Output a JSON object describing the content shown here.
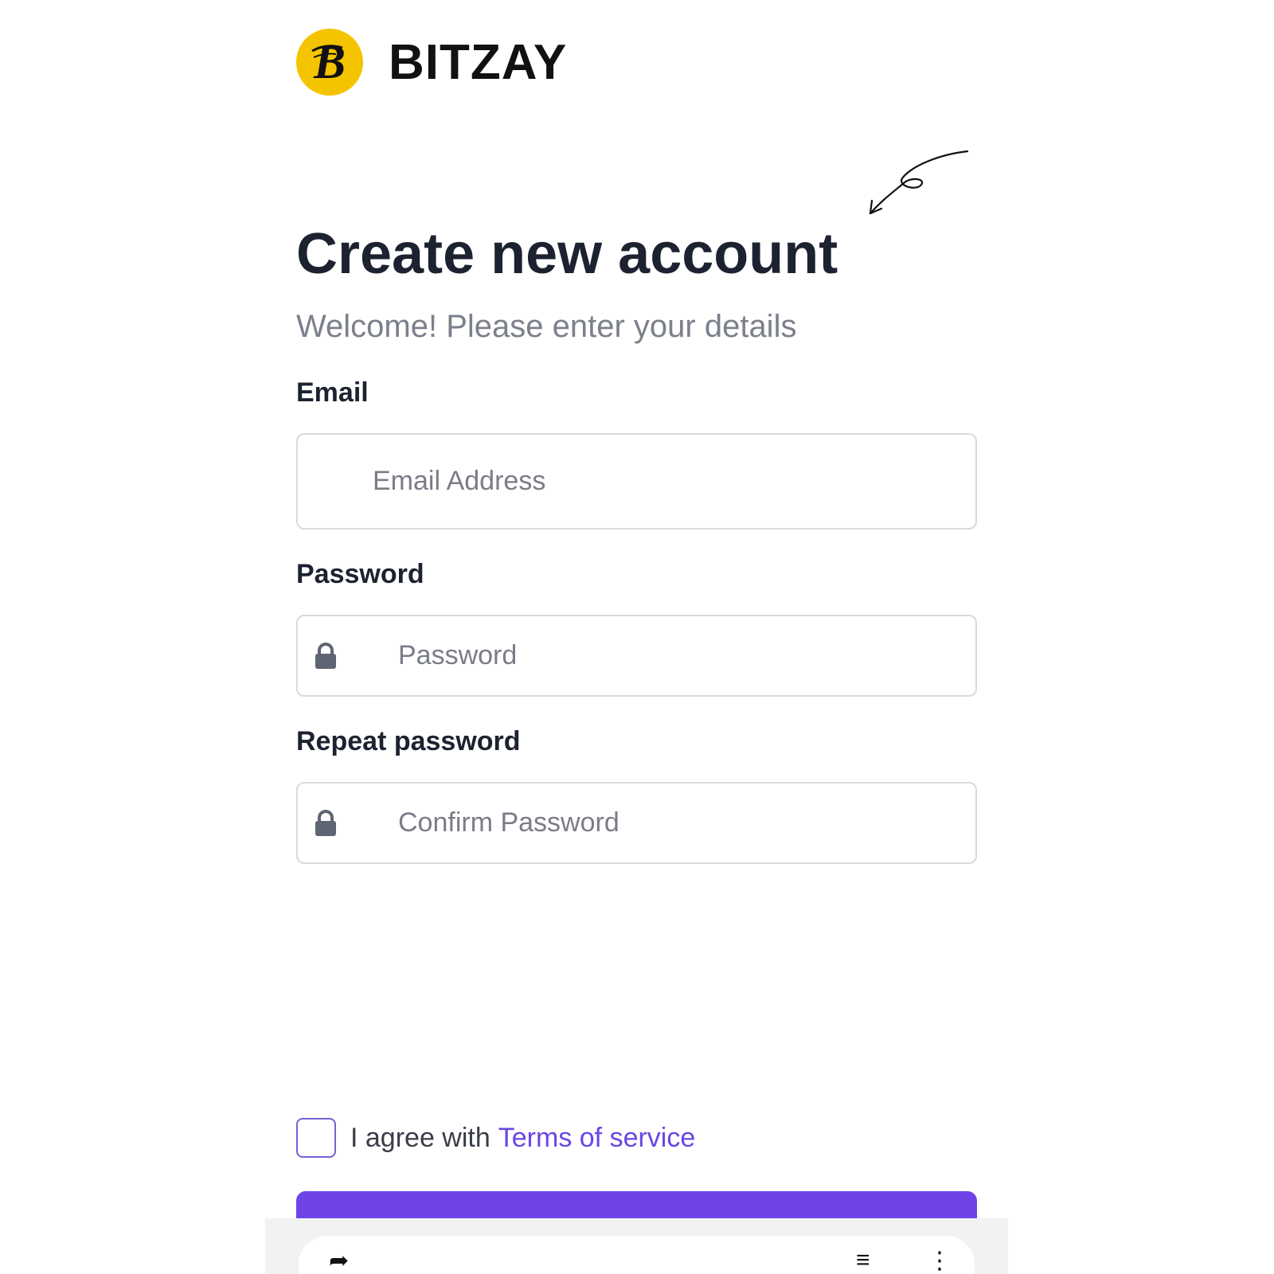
{
  "brand": {
    "name": "BITZAY",
    "logo_letter": "B",
    "logo_color": "#f5c400"
  },
  "header": {
    "title": "Create new account",
    "subtitle": "Welcome! Please enter your details"
  },
  "form": {
    "email": {
      "label": "Email",
      "placeholder": "Email Address",
      "value": ""
    },
    "password": {
      "label": "Password",
      "placeholder": "Password",
      "value": ""
    },
    "repeat_password": {
      "label": "Repeat password",
      "placeholder": "Confirm Password",
      "value": ""
    },
    "terms": {
      "prefix": "I agree with",
      "link": "Terms of service",
      "checked": false
    },
    "submit_color": "#6e44e9"
  },
  "colors": {
    "accent": "#6e44e9",
    "link": "#6a46e6",
    "title": "#1c2230",
    "muted": "#7c7f8c"
  }
}
